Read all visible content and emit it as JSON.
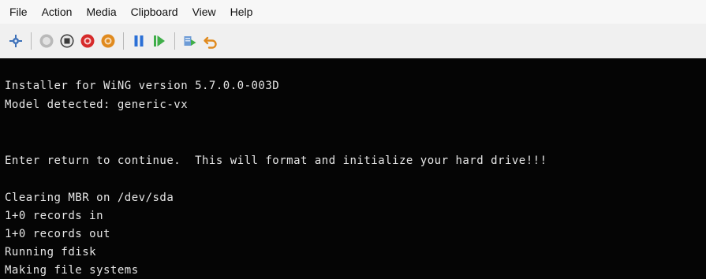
{
  "menu": {
    "file": "File",
    "action": "Action",
    "media": "Media",
    "clipboard": "Clipboard",
    "view": "View",
    "help": "Help"
  },
  "toolbar": {
    "icons": [
      "ctrl-alt-del-icon",
      "start-icon",
      "turn-off-icon",
      "shutdown-icon",
      "save-state-icon",
      "pause-icon",
      "resume-icon",
      "checkpoint-icon",
      "revert-icon"
    ],
    "colors": {
      "gray": "#9a9a9a",
      "red": "#d62a2a",
      "orange": "#e08a1e",
      "blue": "#2a6fd6",
      "green": "#3fae49"
    }
  },
  "console": {
    "lines": [
      "Installer for WiNG version 5.7.0.0-003D",
      "Model detected: generic-vx",
      "",
      "",
      "Enter return to continue.  This will format and initialize your hard drive!!!",
      "",
      "Clearing MBR on /dev/sda",
      "1+0 records in",
      "1+0 records out",
      "Running fdisk",
      "Making file systems"
    ],
    "colors": {
      "background": "#050505",
      "text": "#e6e6e6"
    }
  }
}
